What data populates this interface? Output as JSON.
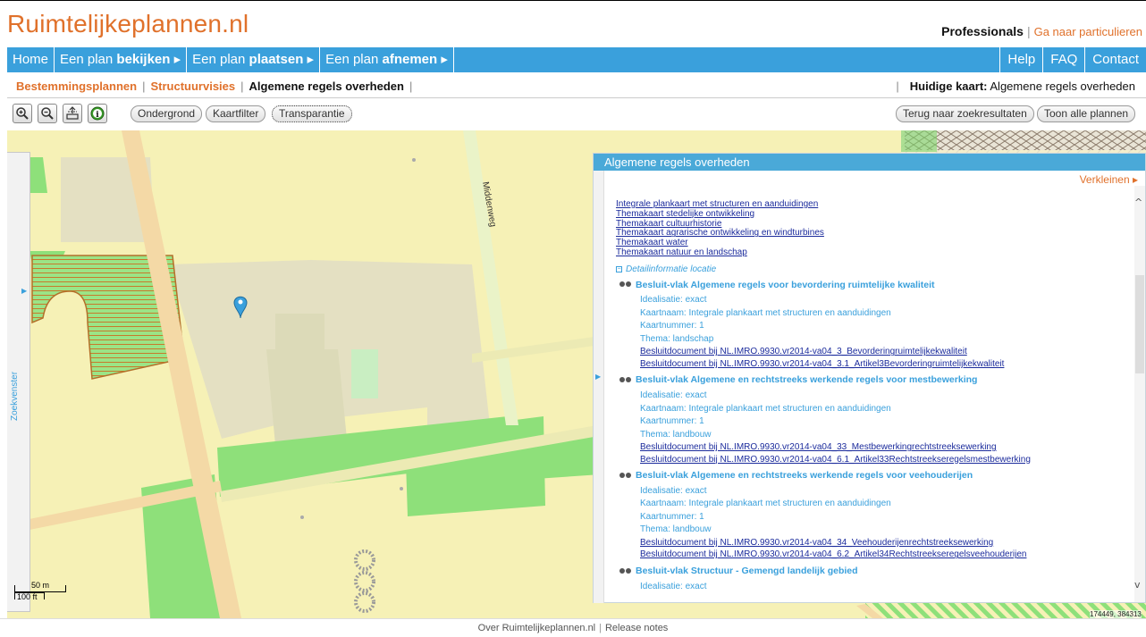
{
  "header": {
    "logo": "Ruimtelijkeplannen.nl",
    "professionals": "Professionals",
    "separator": "|",
    "particulieren": "Ga naar particulieren"
  },
  "nav": {
    "home": "Home",
    "items": [
      {
        "pre": "Een plan ",
        "bold": "bekijken",
        "arrow": " ▸"
      },
      {
        "pre": "Een plan ",
        "bold": "plaatsen",
        "arrow": " ▸"
      },
      {
        "pre": "Een plan ",
        "bold": "afnemen",
        "arrow": " ▸"
      }
    ],
    "help": "Help",
    "faq": "FAQ",
    "contact": "Contact"
  },
  "subnav": {
    "tabs": [
      "Bestemmingsplannen",
      "Structuurvisies",
      "Algemene regels overheden"
    ],
    "current_label": "Huidige kaart:",
    "current_value": "Algemene regels overheden"
  },
  "toolbar": {
    "zoom_in_icon": "zoom-in-icon",
    "zoom_out_icon": "zoom-out-icon",
    "extent_icon": "full-extent-icon",
    "info_icon": "info-icon",
    "ondergrond": "Ondergrond",
    "kaartfilter": "Kaartfilter",
    "transparantie": "Transparantie",
    "terug": "Terug naar zoekresultaten",
    "toon": "Toon alle plannen"
  },
  "map": {
    "road_label": "Middenweg",
    "sidetab_label": "Zoekvenster",
    "scale_m": "50 m",
    "scale_ft": "100 ft",
    "coords": "174449, 384313"
  },
  "panel": {
    "title": "Algemene regels overheden",
    "verkleinen": "Verkleinen ▸",
    "theme_links": [
      "Integrale plankaart met structuren en aanduidingen",
      "Themakaart stedelijke ontwikkeling",
      "Themakaart cultuurhistorie",
      "Themakaart agrarische ontwikkeling en windturbines",
      "Themakaart water",
      "Themakaart natuur en landschap"
    ],
    "detail_label": "Detailinformatie locatie",
    "sections": [
      {
        "title": "Besluit-vlak Algemene regels voor bevordering ruimtelijke kwaliteit",
        "props": [
          "Idealisatie: exact",
          "Kaartnaam: Integrale plankaart met structuren en aanduidingen",
          "Kaartnummer: 1",
          "Thema: landschap"
        ],
        "links": [
          "Besluitdocument bij NL.IMRO.9930.vr2014-va04_3_Bevorderingruimtelijkekwaliteit",
          "Besluitdocument bij NL.IMRO.9930.vr2014-va04_3.1_Artikel3Bevorderingruimtelijkekwaliteit"
        ]
      },
      {
        "title": "Besluit-vlak Algemene en rechtstreeks werkende regels voor mestbewerking",
        "props": [
          "Idealisatie: exact",
          "Kaartnaam: Integrale plankaart met structuren en aanduidingen",
          "Kaartnummer: 1",
          "Thema: landbouw"
        ],
        "links": [
          "Besluitdocument bij NL.IMRO.9930.vr2014-va04_33_Mestbewerkingrechtstreeksewerking",
          "Besluitdocument bij NL.IMRO.9930.vr2014-va04_6.1_Artikel33Rechtstreekseregelsmestbewerking"
        ]
      },
      {
        "title": "Besluit-vlak Algemene en rechtstreeks werkende regels voor veehouderijen",
        "props": [
          "Idealisatie: exact",
          "Kaartnaam: Integrale plankaart met structuren en aanduidingen",
          "Kaartnummer: 1",
          "Thema: landbouw"
        ],
        "links": [
          "Besluitdocument bij NL.IMRO.9930.vr2014-va04_34_Veehouderijenrechtstreeksewerking",
          "Besluitdocument bij NL.IMRO.9930.vr2014-va04_6.2_Artikel34Rechtstreekseregelsveehouderijen"
        ]
      },
      {
        "title": "Besluit-vlak Structuur - Gemengd landelijk gebied",
        "props": [
          "Idealisatie: exact"
        ],
        "links": []
      }
    ]
  },
  "footer": {
    "about": "Over Ruimtelijkeplannen.nl",
    "separator": "|",
    "release": "Release notes"
  },
  "colors": {
    "accent_orange": "#e0712b",
    "nav_blue": "#3aa0dc",
    "map_yellow": "#f6f1b6",
    "map_green": "#8ee07a",
    "link_blue": "#1b2b9c"
  }
}
